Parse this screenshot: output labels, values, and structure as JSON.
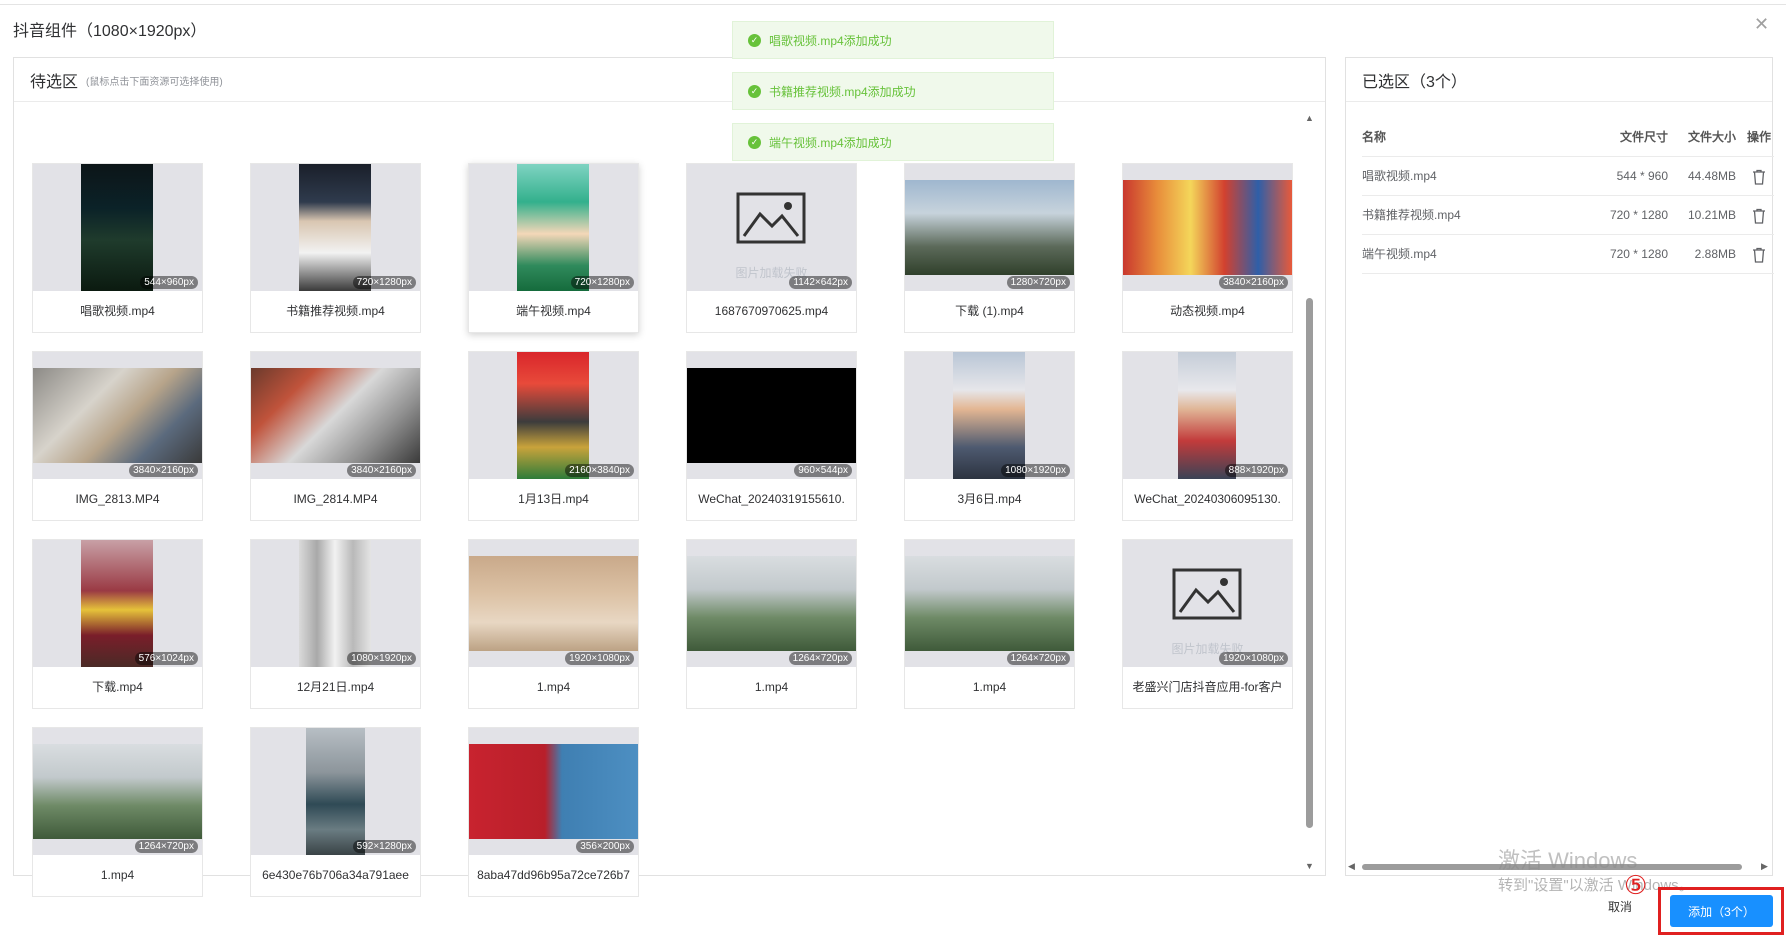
{
  "dialog": {
    "title": "抖音组件（1080×1920px）"
  },
  "toasts": [
    {
      "text": "唱歌视频.mp4添加成功"
    },
    {
      "text": "书籍推荐视频.mp4添加成功"
    },
    {
      "text": "端午视频.mp4添加成功"
    }
  ],
  "candidate": {
    "title": "待选区",
    "hint": "(鼠标点击下面资源可选择使用)",
    "items": [
      {
        "name": "唱歌视频.mp4",
        "dim": "544×960px"
      },
      {
        "name": "书籍推荐视频.mp4",
        "dim": "720×1280px"
      },
      {
        "name": "端午视频.mp4",
        "dim": "720×1280px"
      },
      {
        "name": "1687670970625.mp4",
        "dim": "1142×642px",
        "fail_text": "图片加载失败"
      },
      {
        "name": "下载 (1).mp4",
        "dim": "1280×720px"
      },
      {
        "name": "动态视频.mp4",
        "dim": "3840×2160px"
      },
      {
        "name": "IMG_2813.MP4",
        "dim": "3840×2160px"
      },
      {
        "name": "IMG_2814.MP4",
        "dim": "3840×2160px"
      },
      {
        "name": "1月13日.mp4",
        "dim": "2160×3840px"
      },
      {
        "name": "WeChat_20240319155610.",
        "dim": "960×544px"
      },
      {
        "name": "3月6日.mp4",
        "dim": "1080×1920px"
      },
      {
        "name": "WeChat_20240306095130.",
        "dim": "888×1920px"
      },
      {
        "name": "下载.mp4",
        "dim": "576×1024px"
      },
      {
        "name": "12月21日.mp4",
        "dim": "1080×1920px"
      },
      {
        "name": "1.mp4",
        "dim": "1920×1080px"
      },
      {
        "name": "1.mp4",
        "dim": "1264×720px"
      },
      {
        "name": "1.mp4",
        "dim": "1264×720px"
      },
      {
        "name": "老盛兴门店抖音应用-for客户",
        "dim": "1920×1080px",
        "fail_text": "图片加载失败"
      },
      {
        "name": "1.mp4",
        "dim": "1264×720px"
      },
      {
        "name": "6e430e76b706a34a791aee",
        "dim": "592×1280px"
      },
      {
        "name": "8aba47dd96b95a72ce726b7",
        "dim": "356×200px"
      }
    ]
  },
  "selected": {
    "title": "已选区（3个）",
    "columns": [
      "名称",
      "文件尺寸",
      "文件大小",
      "操作"
    ],
    "rows": [
      {
        "name": "唱歌视频.mp4",
        "size": "544 * 960",
        "filesize": "44.48MB"
      },
      {
        "name": "书籍推荐视频.mp4",
        "size": "720 * 1280",
        "filesize": "10.21MB"
      },
      {
        "name": "端午视频.mp4",
        "size": "720 * 1280",
        "filesize": "2.88MB"
      }
    ]
  },
  "footer": {
    "cancel_label": "取消",
    "add_label": "添加（3个）",
    "step_badge": "⑤"
  },
  "watermark": {
    "line1": "激活 Windows",
    "line2": "转到\"设置\"以激活 Windows。"
  }
}
